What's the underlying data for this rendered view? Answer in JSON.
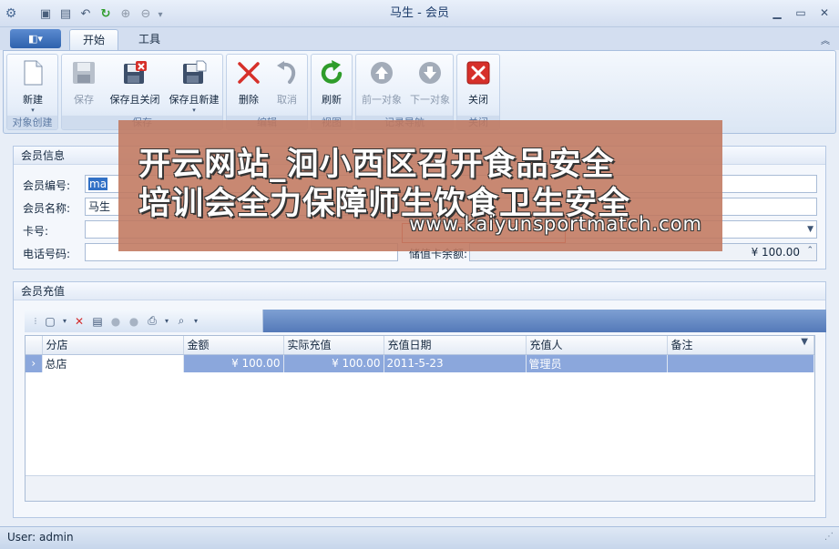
{
  "window": {
    "title": "马生 - 会员"
  },
  "ribbon": {
    "app_menu_glyph": "◧▾",
    "tabs": [
      {
        "label": "开始",
        "active": true
      },
      {
        "label": "工具",
        "active": false
      }
    ],
    "groups": [
      {
        "label": "对象创建",
        "buttons": [
          {
            "label": "新建",
            "icon": "new-document-icon",
            "enabled": true
          }
        ]
      },
      {
        "label": "保存",
        "buttons": [
          {
            "label": "保存",
            "icon": "save-icon",
            "enabled": false
          },
          {
            "label": "保存且关闭",
            "icon": "save-and-close-icon",
            "enabled": true
          },
          {
            "label": "保存且新建",
            "icon": "save-and-new-icon",
            "enabled": true
          }
        ]
      },
      {
        "label": "编辑",
        "buttons": [
          {
            "label": "删除",
            "icon": "delete-x-icon",
            "enabled": true
          },
          {
            "label": "取消",
            "icon": "undo-icon",
            "enabled": false
          }
        ]
      },
      {
        "label": "视图",
        "buttons": [
          {
            "label": "刷新",
            "icon": "refresh-icon",
            "enabled": true
          }
        ]
      },
      {
        "label": "记录导航",
        "buttons": [
          {
            "label": "前一对象",
            "icon": "arrow-up-icon",
            "enabled": false
          },
          {
            "label": "下一对象",
            "icon": "arrow-down-icon",
            "enabled": false
          }
        ]
      },
      {
        "label": "关闭",
        "buttons": [
          {
            "label": "关闭",
            "icon": "close-red-icon",
            "enabled": true
          }
        ]
      }
    ]
  },
  "member_info": {
    "title": "会员信息",
    "fields": {
      "member_no_label": "会员编号:",
      "member_no_value": "ma",
      "member_name_label": "会员名称:",
      "member_name_value": "马生",
      "card_no_label": "卡号:",
      "card_no_value": "",
      "phone_label": "电话号码:",
      "phone_value": "",
      "balance_label": "储值卡余额:",
      "balance_value": "¥ 100.00"
    }
  },
  "recharge": {
    "title": "会员充值",
    "columns": [
      "分店",
      "金额",
      "实际充值",
      "充值日期",
      "充值人",
      "备注"
    ],
    "rows": [
      {
        "branch": "总店",
        "amount": "¥ 100.00",
        "actual": "¥ 100.00",
        "date": "2011-5-23",
        "operator": "管理员",
        "note": ""
      }
    ]
  },
  "status": {
    "user_text": "User: admin"
  },
  "watermark": {
    "line1": "开云网站_洄小西区召开食品安全",
    "line2": "培训会全力保障师生饮食卫生安全",
    "url": "www.kaiyunsportmatch.com"
  },
  "colors": {
    "accent": "#2e62ad",
    "selected_row": "#8ba7dc",
    "overlay": "#c0785f"
  }
}
